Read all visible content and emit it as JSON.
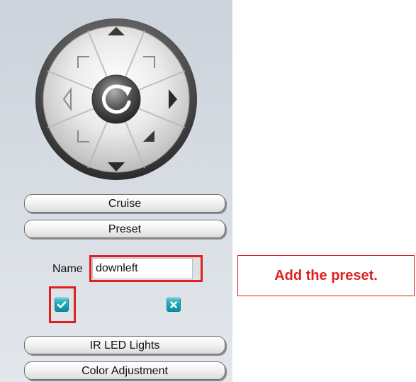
{
  "ptz": {
    "center_icon": "refresh-icon",
    "directions": [
      "up",
      "up-right",
      "right",
      "down-right",
      "down",
      "down-left",
      "left",
      "up-left"
    ]
  },
  "menu": {
    "cruise_label": "Cruise",
    "preset_label": "Preset",
    "ir_label": "IR LED Lights",
    "color_label": "Color Adjustment"
  },
  "preset_form": {
    "name_label": "Name",
    "name_value": "downleft",
    "add_icon": "check-icon",
    "cancel_icon": "close-icon"
  },
  "annotation": {
    "callout_text": "Add the preset.",
    "highlight_color": "#e02020"
  },
  "colors": {
    "panel_bg": "#d6dce2",
    "icon_button": "#1aa0b4"
  }
}
